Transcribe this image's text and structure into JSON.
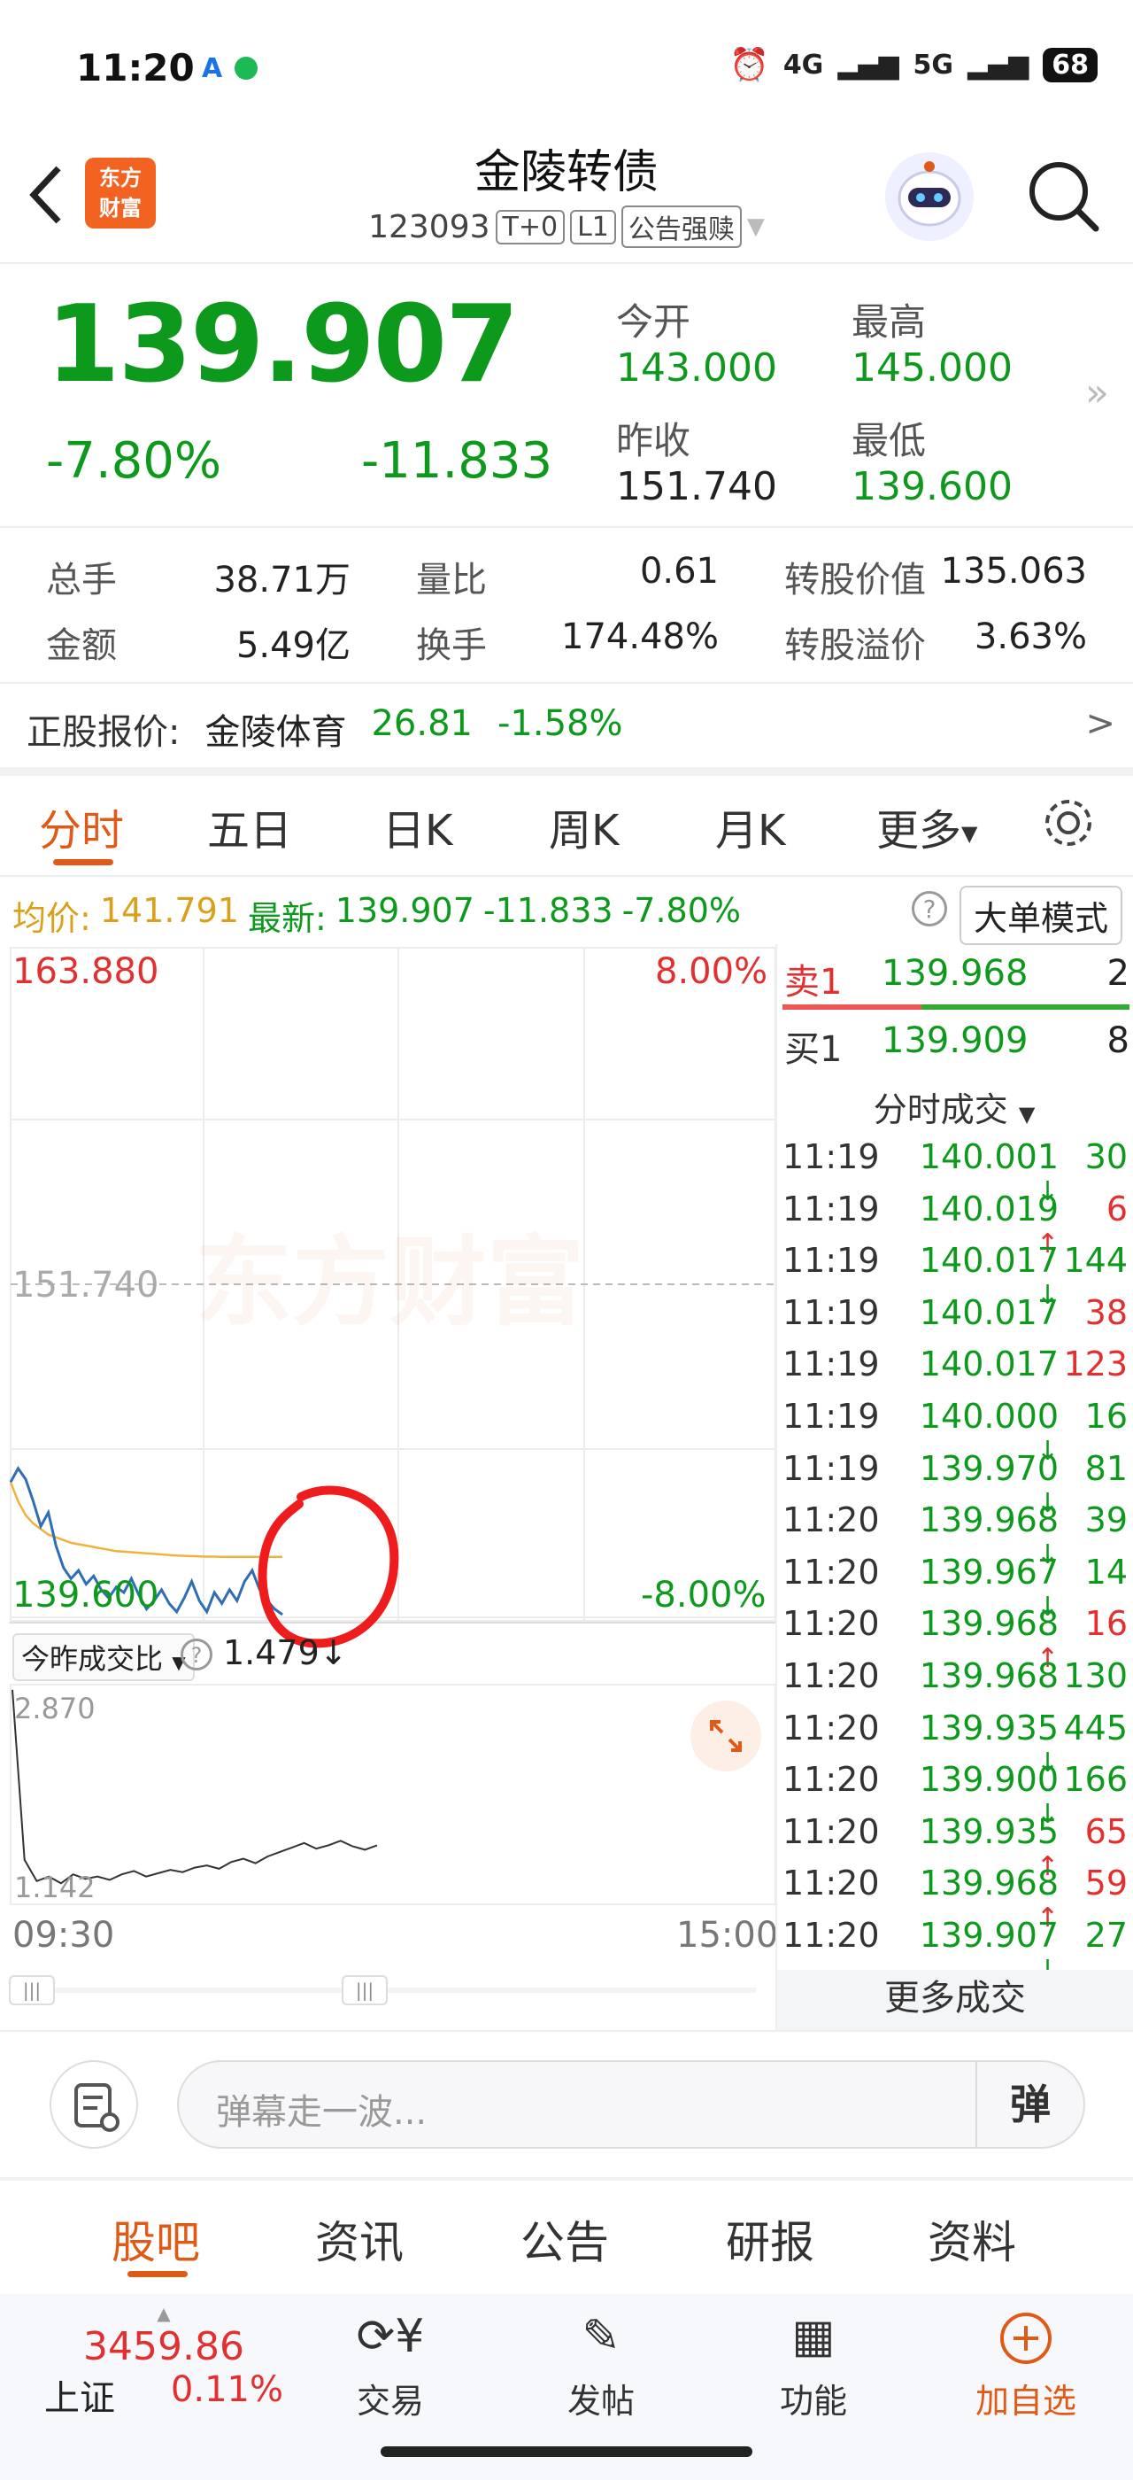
{
  "status": {
    "time": "11:20",
    "net1": "4G",
    "net2": "5G",
    "battery": "68"
  },
  "header": {
    "title": "金陵转债",
    "code": "123093",
    "tags": [
      "T+0",
      "L1",
      "公告强赎"
    ],
    "logo_line1": "东方",
    "logo_line2": "财富"
  },
  "quote": {
    "price": "139.907",
    "change_pct": "-7.80%",
    "change_abs": "-11.833",
    "open_label": "今开",
    "open": "143.000",
    "high_label": "最高",
    "high": "145.000",
    "prev_label": "昨收",
    "prev": "151.740",
    "low_label": "最低",
    "low": "139.600"
  },
  "stats": {
    "vol_label": "总手",
    "vol": "38.71万",
    "ratio_label": "量比",
    "ratio": "0.61",
    "conv_value_label": "转股价值",
    "conv_value": "135.063",
    "amount_label": "金额",
    "amount": "5.49亿",
    "turnover_label": "换手",
    "turnover": "174.48%",
    "premium_label": "转股溢价",
    "premium": "3.63%"
  },
  "underlying": {
    "label": "正股报价:",
    "name": "金陵体育",
    "price": "26.81",
    "pct": "-1.58%"
  },
  "tabs": [
    "分时",
    "五日",
    "日K",
    "周K",
    "月K",
    "更多"
  ],
  "infobar": {
    "avg_label": "均价:",
    "avg": "141.791",
    "latest_label": "最新:",
    "latest": "139.907",
    "chg": "-11.833",
    "pct": "-7.80%",
    "mode": "大单模式"
  },
  "chart_data": {
    "type": "line",
    "ylim": [
      139.6,
      163.88
    ],
    "top_label": "163.880",
    "top_pct": "8.00%",
    "mid_label": "151.740",
    "bottom_label": "139.600",
    "bottom_pct": "-8.00%",
    "x_start": "09:30",
    "x_end": "15:00",
    "watermark": "东方财富",
    "series": [
      {
        "values": [
          144.5,
          145.0,
          144.6,
          143.8,
          142.9,
          143.4,
          142.2,
          141.4,
          141.0,
          141.3,
          140.8,
          141.1,
          140.6,
          140.3,
          140.7,
          140.5,
          141.0,
          140.4,
          139.9,
          140.2,
          140.6,
          140.1,
          139.8,
          140.3,
          140.9,
          140.2,
          139.8,
          140.5,
          140.1,
          140.6,
          140.2,
          140.9,
          141.3,
          140.6,
          140.2,
          139.9,
          139.7
        ]
      },
      {
        "values": [
          144.5,
          143.8,
          143.3,
          143.0,
          142.8,
          142.6,
          142.5,
          142.4,
          142.3,
          142.25,
          142.2,
          142.15,
          142.1,
          142.05,
          142.0,
          141.98,
          141.96,
          141.94,
          141.92,
          141.9,
          141.88,
          141.86,
          141.84,
          141.83,
          141.82,
          141.81,
          141.8,
          141.8,
          141.79,
          141.79,
          141.79,
          141.79,
          141.79,
          141.79,
          141.79,
          141.79,
          141.79
        ]
      }
    ],
    "sub_label": "今昨成交比",
    "sub_value": "1.479",
    "sub_top": "2.870",
    "sub_bottom": "1.142",
    "sub_values": [
      2.87,
      1.35,
      1.16,
      1.2,
      1.14,
      1.22,
      1.18,
      1.2,
      1.17,
      1.22,
      1.25,
      1.2,
      1.23,
      1.26,
      1.24,
      1.28,
      1.3,
      1.27,
      1.33,
      1.36,
      1.32,
      1.38,
      1.42,
      1.46,
      1.5,
      1.45,
      1.48,
      1.52,
      1.47,
      1.44,
      1.48
    ]
  },
  "orderbook": {
    "sell_label": "卖1",
    "sell_price": "139.968",
    "sell_vol": "2",
    "buy_label": "买1",
    "buy_price": "139.909",
    "buy_vol": "8",
    "trades_title": "分时成交",
    "more": "更多成交"
  },
  "trades": [
    {
      "time": "11:19",
      "price": "140.001",
      "dir": "↓",
      "vol": "30",
      "vc": "green"
    },
    {
      "time": "11:19",
      "price": "140.019",
      "dir": "↑",
      "vol": "6",
      "vc": "red"
    },
    {
      "time": "11:19",
      "price": "140.017",
      "dir": "↓",
      "vol": "144",
      "vc": "green"
    },
    {
      "time": "11:19",
      "price": "140.017",
      "dir": "",
      "vol": "38",
      "vc": "red"
    },
    {
      "time": "11:19",
      "price": "140.017",
      "dir": "",
      "vol": "123",
      "vc": "red"
    },
    {
      "time": "11:19",
      "price": "140.000",
      "dir": "↓",
      "vol": "16",
      "vc": "green"
    },
    {
      "time": "11:19",
      "price": "139.970",
      "dir": "↓",
      "vol": "81",
      "vc": "green"
    },
    {
      "time": "11:20",
      "price": "139.968",
      "dir": "↓",
      "vol": "39",
      "vc": "green"
    },
    {
      "time": "11:20",
      "price": "139.967",
      "dir": "↓",
      "vol": "14",
      "vc": "green"
    },
    {
      "time": "11:20",
      "price": "139.968",
      "dir": "↑",
      "vol": "16",
      "vc": "red"
    },
    {
      "time": "11:20",
      "price": "139.968",
      "dir": "",
      "vol": "130",
      "vc": "green"
    },
    {
      "time": "11:20",
      "price": "139.935",
      "dir": "↓",
      "vol": "445",
      "vc": "green"
    },
    {
      "time": "11:20",
      "price": "139.900",
      "dir": "↓",
      "vol": "166",
      "vc": "green"
    },
    {
      "time": "11:20",
      "price": "139.935",
      "dir": "↑",
      "vol": "65",
      "vc": "red"
    },
    {
      "time": "11:20",
      "price": "139.968",
      "dir": "↑",
      "vol": "59",
      "vc": "red"
    },
    {
      "time": "11:20",
      "price": "139.907",
      "dir": "↓",
      "vol": "27",
      "vc": "green"
    }
  ],
  "danmu": {
    "placeholder": "弹幕走一波...",
    "btn": "弹"
  },
  "nav": [
    "股吧",
    "资讯",
    "公告",
    "研报",
    "资料"
  ],
  "bottom": {
    "index_value": "3459.86",
    "index_name": "上证",
    "index_pct": "0.11%",
    "trade": "交易",
    "post": "发帖",
    "func": "功能",
    "watch": "加自选"
  },
  "colors": {
    "up": "#e23030",
    "down": "#0d9a1c",
    "accent": "#e05a17",
    "avg": "#f0b33a",
    "line": "#2f6db5"
  }
}
